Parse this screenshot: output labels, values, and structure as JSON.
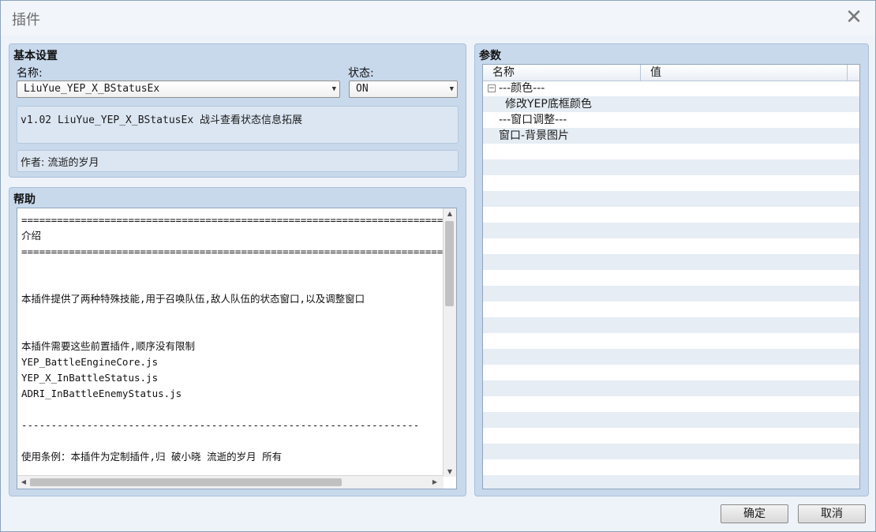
{
  "window": {
    "title": "插件"
  },
  "basic": {
    "section_title": "基本设置",
    "name_label": "名称:",
    "name_value": "LiuYue_YEP_X_BStatusEx",
    "state_label": "状态:",
    "state_value": "ON",
    "description": "v1.02 LiuYue_YEP_X_BStatusEx 战斗查看状态信息拓展",
    "author": "作者: 流逝的岁月"
  },
  "help": {
    "section_title": "帮助",
    "lines": [
      "===========================================================================",
      "介绍",
      "===========================================================================",
      "",
      "",
      "本插件提供了两种特殊技能,用于召唤队伍,敌人队伍的状态窗口,以及调整窗口",
      "",
      "",
      "本插件需要这些前置插件,顺序没有限制",
      "YEP_BattleEngineCore.js",
      "YEP_X_InBattleStatus.js",
      "ADRI_InBattleEnemyStatus.js",
      "",
      "-------------------------------------------------------------------",
      "",
      "使用条例：本插件为定制插件,归 破小晓 流逝的岁月 所有"
    ]
  },
  "params": {
    "section_title": "参数",
    "col_name": "名称",
    "col_value": "值",
    "rows": [
      {
        "name": "---颜色---",
        "expander": "⊟"
      },
      {
        "name": "修改YEP底框颜色"
      },
      {
        "name": "---窗口调整---"
      },
      {
        "name": "窗口-背景图片"
      }
    ]
  },
  "buttons": {
    "ok": "确定",
    "cancel": "取消"
  }
}
